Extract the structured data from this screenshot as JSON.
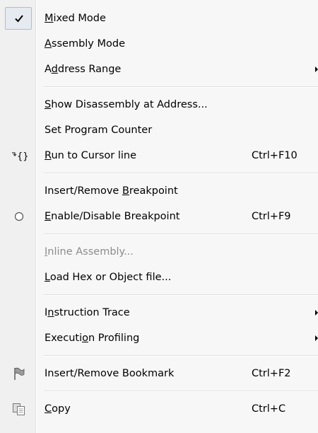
{
  "menu": {
    "items": [
      {
        "id": "mixed-mode",
        "label": "Mixed Mode",
        "mnemonic": 0,
        "checked": true,
        "shortcut": "",
        "submenu": false,
        "disabled": false,
        "icon": "checkmark-icon"
      },
      {
        "id": "assembly-mode",
        "label": "Assembly Mode",
        "mnemonic": 0,
        "shortcut": "",
        "submenu": false,
        "disabled": false,
        "icon": ""
      },
      {
        "id": "address-range",
        "label": "Address Range",
        "mnemonic": 1,
        "shortcut": "",
        "submenu": true,
        "disabled": false,
        "icon": ""
      },
      {
        "separator": true
      },
      {
        "id": "show-disassembly-at-address",
        "label": "Show Disassembly at Address...",
        "mnemonic": 0,
        "shortcut": "",
        "submenu": false,
        "disabled": false,
        "icon": ""
      },
      {
        "id": "set-program-counter",
        "label": "Set Program Counter",
        "mnemonic": -1,
        "shortcut": "",
        "submenu": false,
        "disabled": false,
        "icon": ""
      },
      {
        "id": "run-to-cursor-line",
        "label": "Run to Cursor line",
        "mnemonic": 0,
        "shortcut": "Ctrl+F10",
        "submenu": false,
        "disabled": false,
        "icon": "run-to-cursor-icon"
      },
      {
        "separator": true
      },
      {
        "id": "insert-remove-breakpoint",
        "label": "Insert/Remove Breakpoint",
        "mnemonic": 14,
        "shortcut": "",
        "submenu": false,
        "disabled": false,
        "icon": ""
      },
      {
        "id": "enable-disable-breakpoint",
        "label": "Enable/Disable Breakpoint",
        "mnemonic": 0,
        "shortcut": "Ctrl+F9",
        "submenu": false,
        "disabled": false,
        "icon": "breakpoint-circle-icon"
      },
      {
        "separator": true
      },
      {
        "id": "inline-assembly",
        "label": "Inline Assembly...",
        "mnemonic": 0,
        "shortcut": "",
        "submenu": false,
        "disabled": true,
        "icon": ""
      },
      {
        "id": "load-hex-or-object-file",
        "label": "Load Hex or Object file...",
        "mnemonic": 0,
        "shortcut": "",
        "submenu": false,
        "disabled": false,
        "icon": ""
      },
      {
        "separator": true
      },
      {
        "id": "instruction-trace",
        "label": "Instruction Trace",
        "mnemonic": 1,
        "shortcut": "",
        "submenu": true,
        "disabled": false,
        "icon": ""
      },
      {
        "id": "execution-profiling",
        "label": "Execution Profiling",
        "mnemonic": 7,
        "shortcut": "",
        "submenu": true,
        "disabled": false,
        "icon": ""
      },
      {
        "separator": true
      },
      {
        "id": "insert-remove-bookmark",
        "label": "Insert/Remove Bookmark",
        "mnemonic": -1,
        "shortcut": "Ctrl+F2",
        "submenu": false,
        "disabled": false,
        "icon": "bookmark-flag-icon"
      },
      {
        "separator": true
      },
      {
        "id": "copy",
        "label": "Copy",
        "mnemonic": 0,
        "shortcut": "Ctrl+C",
        "submenu": false,
        "disabled": false,
        "icon": "copy-icon"
      }
    ]
  },
  "colors": {
    "menu_background": "#f7f7f7",
    "gutter_background": "#f0f0f0",
    "disabled_text": "#8c8c8c",
    "checkbox_highlight": "#e6ebf2"
  }
}
